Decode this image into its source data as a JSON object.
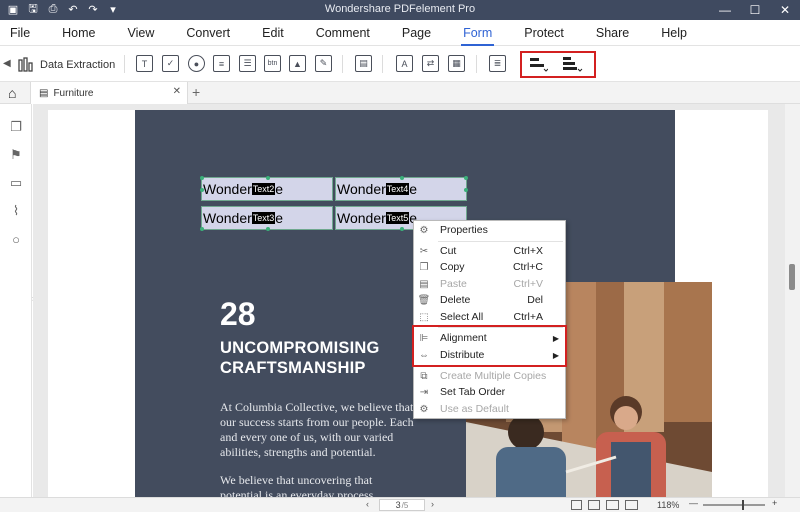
{
  "app": {
    "title": "Wondershare PDFelement Pro"
  },
  "menu": [
    "File",
    "Home",
    "View",
    "Convert",
    "Edit",
    "Comment",
    "Page",
    "Form",
    "Protect",
    "Share",
    "Help"
  ],
  "menu_active": "Form",
  "toolbar": {
    "data_extraction": "Data Extraction"
  },
  "tab": {
    "name": "Furniture"
  },
  "fields": [
    {
      "base": "Wonder",
      "tag": "Text2",
      "tail": "e"
    },
    {
      "base": "Wonder",
      "tag": "Text4",
      "tail": "e"
    },
    {
      "base": "Wonder",
      "tag": "Text3",
      "tail": "e"
    },
    {
      "base": "Wonder",
      "tag": "Text5",
      "tail": "e"
    }
  ],
  "doc": {
    "number": "28",
    "heading_l1": "UNCOMPROMISING",
    "heading_l2": "CRAFTSMANSHIP",
    "p1": [
      "At Columbia Collective, we believe that",
      "our success starts from our people. Each",
      "and every one of us, with our varied",
      "abilities, strengths and potential."
    ],
    "p2": [
      "We believe that uncovering that",
      "potential is an everyday process."
    ]
  },
  "context_menu": {
    "properties": "Properties",
    "cut": "Cut",
    "cut_sc": "Ctrl+X",
    "copy": "Copy",
    "copy_sc": "Ctrl+C",
    "paste": "Paste",
    "paste_sc": "Ctrl+V",
    "delete": "Delete",
    "delete_sc": "Del",
    "select_all": "Select All",
    "select_all_sc": "Ctrl+A",
    "alignment": "Alignment",
    "distribute": "Distribute",
    "create_multiple": "Create Multiple Copies",
    "tab_order": "Set Tab Order",
    "use_default": "Use as Default"
  },
  "status": {
    "page_current": "3",
    "page_total": "/5",
    "zoom": "118%"
  },
  "colors": {
    "titlebar": "#3f4a60",
    "accent": "#2f63d4",
    "highlight": "#d32020",
    "page_dark": "#434c5e"
  }
}
